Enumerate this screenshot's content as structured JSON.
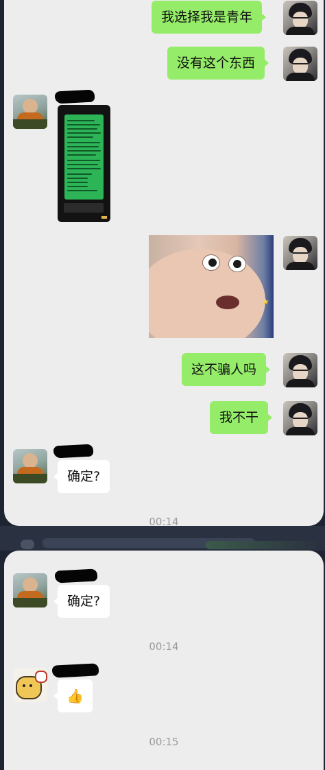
{
  "chat_top": {
    "messages": [
      {
        "sender": "me",
        "type": "text",
        "text": "我选择我是青年"
      },
      {
        "sender": "me",
        "type": "text",
        "text": "没有这个东西"
      },
      {
        "sender": "other",
        "type": "image",
        "description": "phone-screenshot-of-chat"
      },
      {
        "sender": "me",
        "type": "image",
        "description": "surprised-baby-meme"
      },
      {
        "sender": "me",
        "type": "text",
        "text": "这不骗人吗"
      },
      {
        "sender": "me",
        "type": "text",
        "text": "我不干"
      },
      {
        "sender": "other",
        "type": "text",
        "text": "确定?"
      }
    ],
    "timestamp": "00:14"
  },
  "chat_bottom": {
    "messages": [
      {
        "sender": "other",
        "type": "text",
        "text": "确定?"
      }
    ],
    "timestamp_1": "00:14",
    "thumb_emoji": "👍",
    "timestamp_2": "00:15"
  },
  "colors": {
    "my_bubble": "#95ec69",
    "other_bubble": "#ffffff",
    "chat_background": "#ededed",
    "timestamp": "#9b9b9b"
  },
  "icons": [
    "avatar-me",
    "avatar-other",
    "avatar-dog",
    "thumbs-up-icon"
  ]
}
